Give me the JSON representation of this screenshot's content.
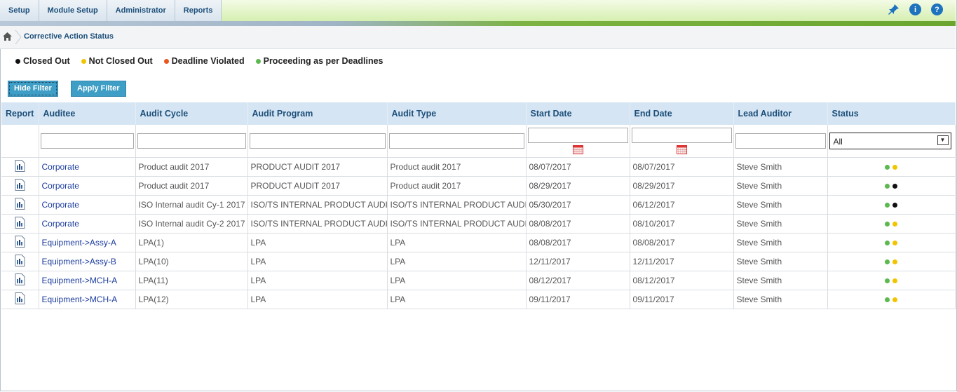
{
  "menu": [
    "Setup",
    "Module Setup",
    "Administrator",
    "Reports"
  ],
  "top_icons": [
    {
      "name": "pin-icon",
      "glyph": "✦",
      "color": "#1e73be"
    },
    {
      "name": "info-icon",
      "glyph": "i",
      "color": "#1e73be"
    },
    {
      "name": "help-icon",
      "glyph": "?",
      "color": "#1e73be"
    }
  ],
  "breadcrumb": {
    "title": "Corrective Action Status"
  },
  "legend": [
    {
      "label": "Closed Out",
      "color": "#111111"
    },
    {
      "label": "Not Closed Out",
      "color": "#f2c400"
    },
    {
      "label": "Deadline Violated",
      "color": "#e8571e"
    },
    {
      "label": "Proceeding as per Deadlines",
      "color": "#5cb84f"
    }
  ],
  "buttons": {
    "hide_filter": "Hide Filter",
    "apply_filter": "Apply Filter"
  },
  "table": {
    "headers": [
      "Report",
      "Auditee",
      "Audit Cycle",
      "Audit Program",
      "Audit Type",
      "Start Date",
      "End Date",
      "Lead Auditor",
      "Status"
    ],
    "status_filter": "All",
    "rows": [
      {
        "auditee": "Corporate",
        "cycle": "Product audit 2017",
        "program": "PRODUCT AUDIT 2017",
        "type": "Product audit 2017",
        "start": "08/07/2017",
        "end": "08/07/2017",
        "lead": "Steve Smith",
        "status": [
          "#5cb84f",
          "#f2c400"
        ]
      },
      {
        "auditee": "Corporate",
        "cycle": "Product audit 2017",
        "program": "PRODUCT AUDIT 2017",
        "type": "Product audit 2017",
        "start": "08/29/2017",
        "end": "08/29/2017",
        "lead": "Steve Smith",
        "status": [
          "#5cb84f",
          "#111111"
        ]
      },
      {
        "auditee": "Corporate",
        "cycle": "ISO Internal audit Cy-1 2017",
        "program": "ISO/TS INTERNAL PRODUCT AUDIT",
        "type": "ISO/TS INTERNAL PRODUCT AUDIT",
        "start": "05/30/2017",
        "end": "06/12/2017",
        "lead": "Steve Smith",
        "status": [
          "#5cb84f",
          "#111111"
        ]
      },
      {
        "auditee": "Corporate",
        "cycle": "ISO Internal audit Cy-2 2017",
        "program": "ISO/TS INTERNAL PRODUCT AUDIT",
        "type": "ISO/TS INTERNAL PRODUCT AUDIT",
        "start": "08/08/2017",
        "end": "08/10/2017",
        "lead": "Steve Smith",
        "status": [
          "#5cb84f",
          "#f2c400"
        ]
      },
      {
        "auditee": "Equipment->Assy-A",
        "cycle": "LPA(1)",
        "program": "LPA",
        "type": "LPA",
        "start": "08/08/2017",
        "end": "08/08/2017",
        "lead": "Steve Smith",
        "status": [
          "#5cb84f",
          "#f2c400"
        ]
      },
      {
        "auditee": "Equipment->Assy-B",
        "cycle": "LPA(10)",
        "program": "LPA",
        "type": "LPA",
        "start": "12/11/2017",
        "end": "12/11/2017",
        "lead": "Steve Smith",
        "status": [
          "#5cb84f",
          "#f2c400"
        ]
      },
      {
        "auditee": "Equipment->MCH-A",
        "cycle": "LPA(11)",
        "program": "LPA",
        "type": "LPA",
        "start": "08/12/2017",
        "end": "08/12/2017",
        "lead": "Steve Smith",
        "status": [
          "#5cb84f",
          "#f2c400"
        ]
      },
      {
        "auditee": "Equipment->MCH-A",
        "cycle": "LPA(12)",
        "program": "LPA",
        "type": "LPA",
        "start": "09/11/2017",
        "end": "09/11/2017",
        "lead": "Steve Smith",
        "status": [
          "#5cb84f",
          "#f2c400"
        ]
      }
    ]
  }
}
